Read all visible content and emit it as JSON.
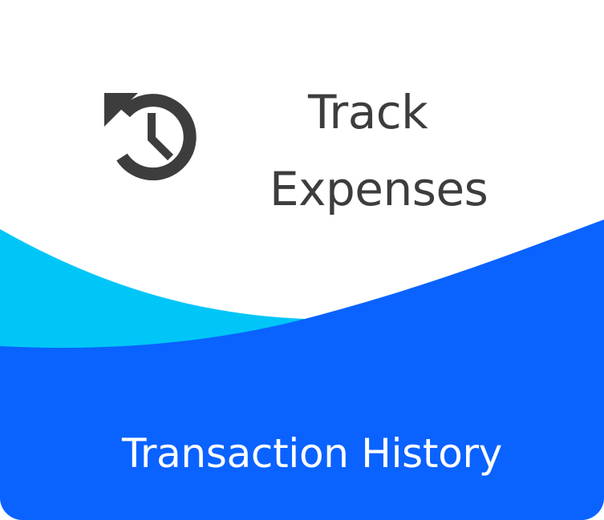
{
  "card": {
    "title_line1": "Track",
    "title_line2": "Expenses",
    "footer_label": "Transaction History",
    "icon": "history-icon"
  },
  "colors": {
    "background": "#ffffff",
    "text_dark": "#3d3d3d",
    "wave_light": "#00c6f8",
    "wave_blue": "#0a62ff",
    "footer_text": "#ffffff"
  }
}
